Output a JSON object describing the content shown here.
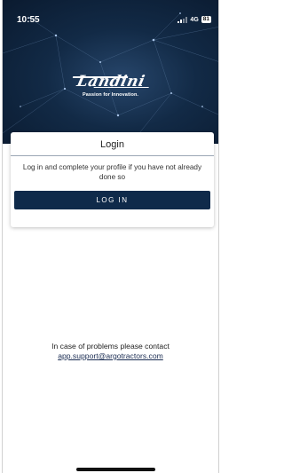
{
  "status_bar": {
    "time": "10:55",
    "network": "4G",
    "battery": "81"
  },
  "brand": {
    "logo_text": "Landini",
    "tagline": "Passion for Innovation."
  },
  "login_card": {
    "title": "Login",
    "message": "Log in and complete your profile if you have not already done so",
    "button_label": "LOG IN"
  },
  "support": {
    "text": "In case of problems please contact",
    "email": "app.support@argotractors.com"
  },
  "colors": {
    "hero_dark": "#0a1a2f",
    "button_bg": "#0f2a4a",
    "link": "#1a2c52"
  }
}
